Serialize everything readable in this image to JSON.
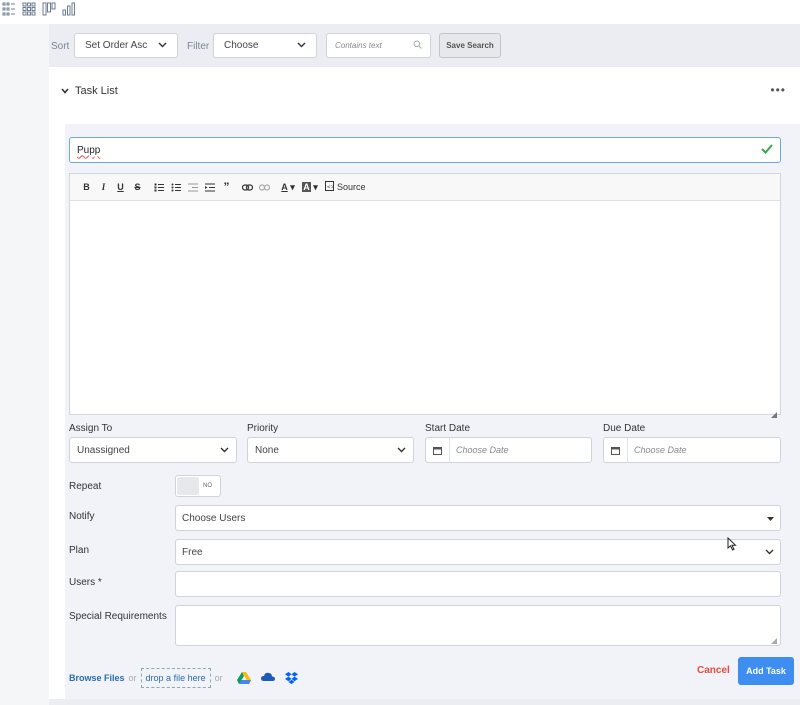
{
  "toolbar": {
    "view_icons": [
      "list-view-icon",
      "grid-view-icon",
      "board-view-icon",
      "chart-view-icon"
    ]
  },
  "search": {
    "sort_label": "Sort",
    "sort_value": "Set Order Asc",
    "filter_label": "Filter",
    "filter_value": "Choose",
    "contains_placeholder": "Contains text",
    "save_search_label": "Save Search"
  },
  "panel": {
    "title": "Task List",
    "more_label": "•••"
  },
  "form": {
    "title_value": "Pupp",
    "editor": {
      "source_label": "Source"
    },
    "assign_to_label": "Assign To",
    "assign_to_value": "Unassigned",
    "priority_label": "Priority",
    "priority_value": "None",
    "start_date_label": "Start Date",
    "start_date_placeholder": "Choose Date",
    "due_date_label": "Due Date",
    "due_date_placeholder": "Choose Date",
    "repeat_label": "Repeat",
    "repeat_state": "NO",
    "notify_label": "Notify",
    "notify_value": "Choose Users",
    "plan_label": "Plan",
    "plan_value": "Free",
    "users_label": "Users *",
    "special_label": "Special Requirements"
  },
  "footer": {
    "browse_label": "Browse Files",
    "or1": "or",
    "drop_label": "drop a file here",
    "or2": "or",
    "cancel_label": "Cancel",
    "add_task_label": "Add Task"
  },
  "colors": {
    "accent": "#3d8ef0",
    "cancel": "#e74c3c",
    "success": "#2eaa4a",
    "background": "#ebedf3"
  }
}
